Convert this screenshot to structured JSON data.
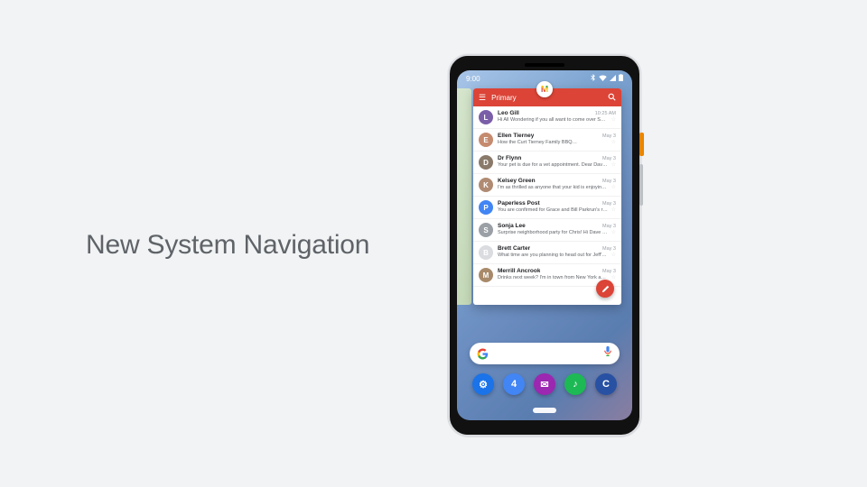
{
  "title": "New System Navigation",
  "statusbar": {
    "time": "9:00"
  },
  "gmail": {
    "primary_label": "Primary",
    "fab_icon": "pencil-icon",
    "emails": [
      {
        "sender": "Leo Gill",
        "date": "10:25 AM",
        "snippet": "Hi All Wondering if you all want to come over S…",
        "avatar_bg": "#7b5ea8"
      },
      {
        "sender": "Ellen Tierney",
        "date": "May 3",
        "snippet": "How the Curt Tierney Family BBQ…",
        "avatar_bg": "#c58b6f"
      },
      {
        "sender": "Dr Flynn",
        "date": "May 3",
        "snippet": "Your pet is due for a vet appointment. Dear Dave, A friendly reminder for your pet…",
        "avatar_bg": "#8a7a6a"
      },
      {
        "sender": "Kelsey Green",
        "date": "May 3",
        "snippet": "I'm as thrilled as anyone that your kid is enjoyin…",
        "avatar_bg": "#b08a72"
      },
      {
        "sender": "Paperless Post",
        "date": "May 3",
        "snippet": "You are confirmed for Grace and Bill Parkrun's re. Paperless Post You replied \"attending\" That mak…",
        "avatar_bg": "#4285f4"
      },
      {
        "sender": "Sonja Lee",
        "date": "May 3",
        "snippet": "Surprise neighborhood party for Chris! Hi Dave and the Roots family, I'm throwing a s…",
        "avatar_bg": "#9aa0a6"
      },
      {
        "sender": "Brett Carter",
        "date": "May 3",
        "snippet": "What time are you planning to head out for Jeff'…",
        "avatar_bg": "#dadce0"
      },
      {
        "sender": "Merrill Ancrook",
        "date": "May 3",
        "snippet": "Drinks next week? I'm in town from New York and would love to he…",
        "avatar_bg": "#a88a6a"
      }
    ]
  },
  "dock": {
    "items": [
      {
        "name": "settings",
        "bg": "#1a73e8",
        "glyph": "⚙"
      },
      {
        "name": "calendar",
        "bg": "#4285f4",
        "glyph": "4"
      },
      {
        "name": "messages",
        "bg": "#9c27b0",
        "glyph": "✉"
      },
      {
        "name": "spotify",
        "bg": "#1db954",
        "glyph": "♪"
      },
      {
        "name": "canva",
        "bg": "#2851a3",
        "glyph": "C"
      }
    ]
  },
  "colors": {
    "gmail_red": "#db4437",
    "fab_red": "#db4437"
  }
}
